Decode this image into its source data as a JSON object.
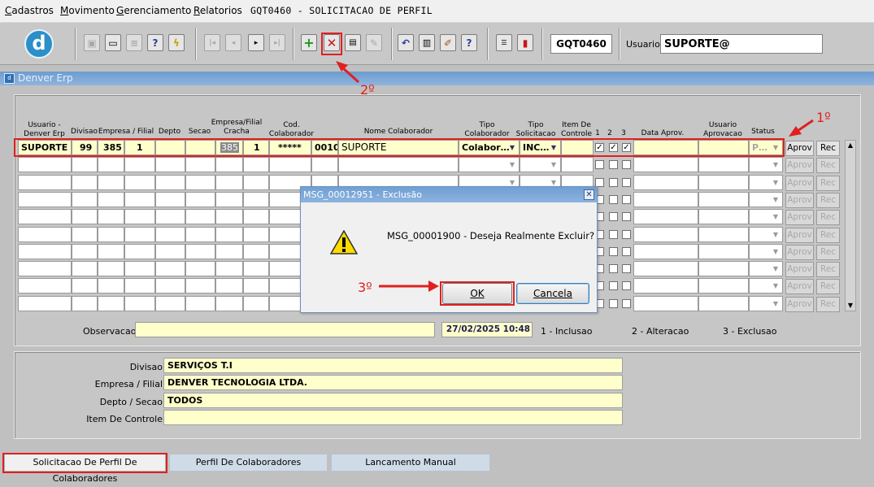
{
  "menu": {
    "items": [
      "Cadastros",
      "Movimento",
      "Gerenciamento",
      "Relatorios"
    ],
    "form_code": "GQT0460 - SOLICITACAO DE PERFIL"
  },
  "toolbar": {
    "logo": "d",
    "screen_code": "GQT0460",
    "user_label": "Usuario",
    "user_value": "SUPORTE@",
    "icons": [
      "save-icon",
      "window-icon",
      "print-icon",
      "query-icon",
      "execute-query-icon",
      "first-record-icon",
      "previous-record-icon",
      "next-record-icon",
      "last-record-icon",
      "insert-record-icon",
      "delete-record-icon",
      "clear-icon",
      "erase-icon",
      "undo-icon",
      "list-icon",
      "edit-icon",
      "help-icon",
      "menu-icon",
      "exit-icon"
    ]
  },
  "window": {
    "title": "Denver Erp"
  },
  "grid": {
    "headers": {
      "usuario": "Usuario -\nDenver Erp",
      "divisao": "Divisao",
      "empresa": "Empresa / Filial",
      "depto": "Depto",
      "secao": "Secao",
      "cracha": "Empresa/Filial\nCracha",
      "cod_colab": "Cod.\nColaborador",
      "nome": "Nome Colaborador",
      "tipo_colab": "Tipo\nColaborador",
      "tipo_sol": "Tipo\nSolicitacao",
      "item": "Item De\nControle",
      "c1": "1",
      "c2": "2",
      "c3": "3",
      "data_aprov": "Data Aprov.",
      "usuario_aprov": "Usuario\nAprovacao",
      "status": "Status"
    },
    "row1": {
      "usuario": "SUPORTE",
      "divisao": "99",
      "empresa": "385",
      "filial": "1",
      "cracha_emp": "385",
      "cracha_fil": "1",
      "cod_colab": "*****",
      "cod_num": "0010",
      "nome": "SUPORTE",
      "tipo_colab": "Colabor…",
      "tipo_sol": "INC…",
      "status": "P…",
      "checks": [
        true,
        true,
        true
      ]
    },
    "aprov_label": "Aprov",
    "rec_label": "Rec",
    "observacao_label": "Observacao",
    "datetime": "27/02/2025 10:48",
    "legend": [
      "1 - Inclusao",
      "2 - Alteracao",
      "3 - Exclusao"
    ]
  },
  "dialog": {
    "title": "MSG_00012951 - Exclusão",
    "message": "MSG_00001900 - Deseja Realmente Excluir?",
    "ok_label": "OK",
    "cancel_label": "Cancela"
  },
  "info": {
    "divisao_label": "Divisao",
    "divisao_value": "SERVIÇOS T.I",
    "empresa_label": "Empresa / Filial",
    "empresa_value": "DENVER TECNOLOGIA LTDA.",
    "depto_label": "Depto / Secao",
    "depto_value": "TODOS",
    "item_label": "Item De Controle",
    "item_value": ""
  },
  "tabs": [
    "Solicitacao De Perfil De Colaboradores",
    "Perfil De Colaboradores",
    "Lancamento Manual"
  ],
  "annotations": {
    "step1": "1º",
    "step2": "2º",
    "step3": "3º",
    "color": "#e02020"
  }
}
